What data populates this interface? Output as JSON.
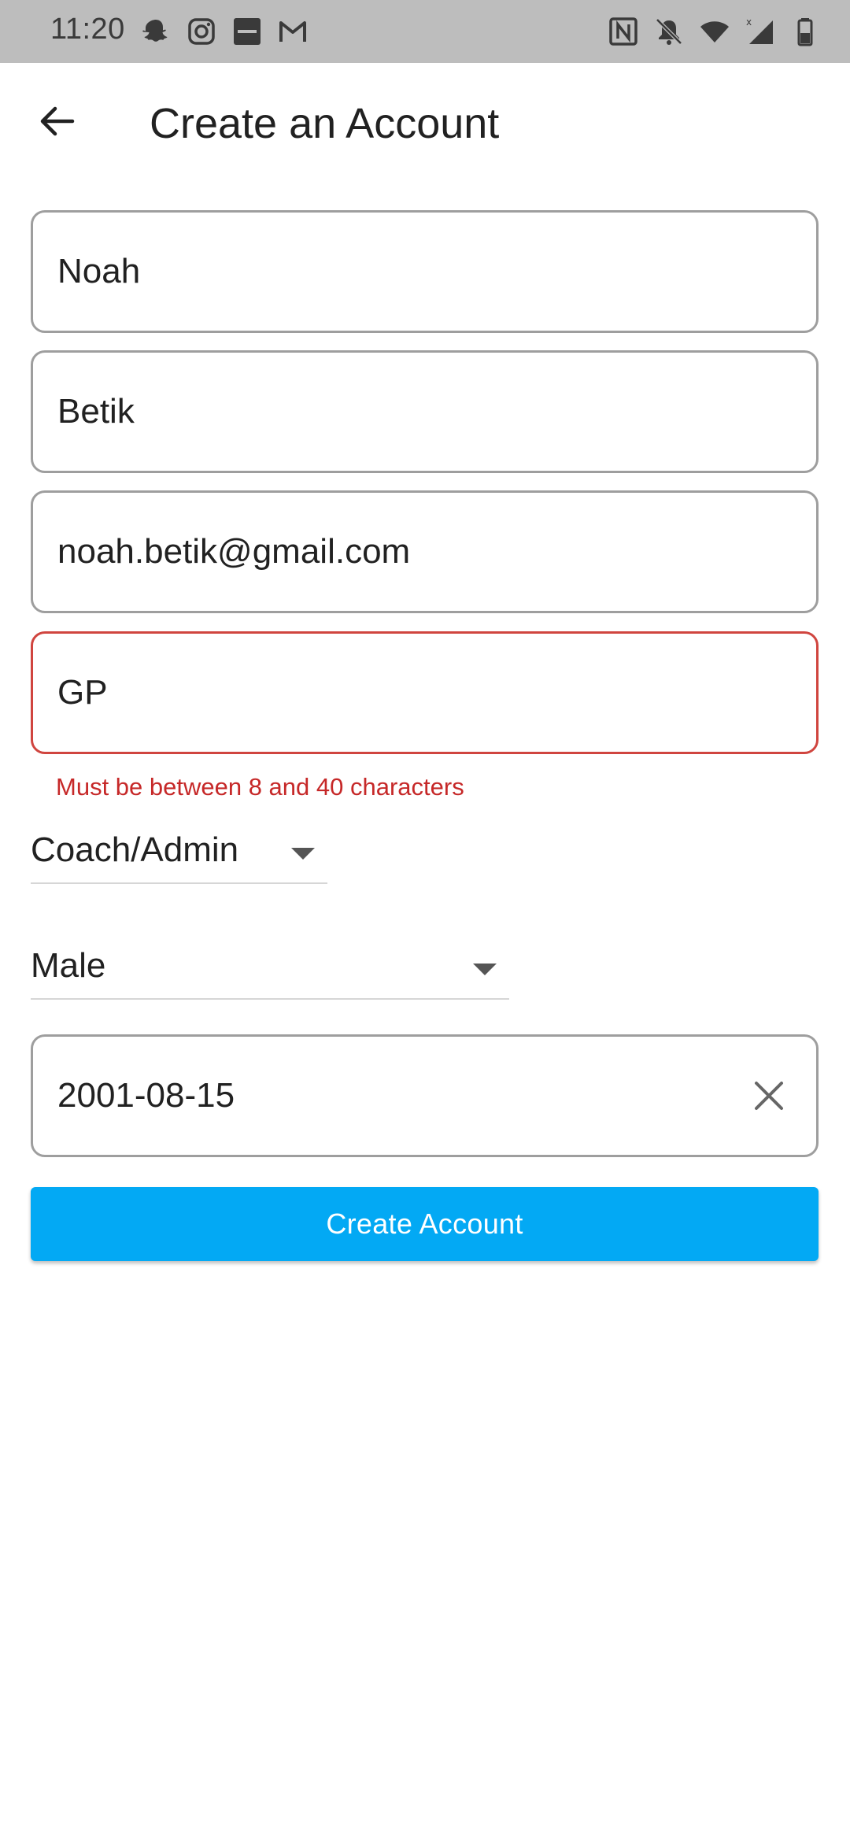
{
  "status_bar": {
    "time": "11:20",
    "left_icons": [
      "snapchat-icon",
      "instagram-icon",
      "tsn-icon",
      "gmail-icon"
    ],
    "right_icons": [
      "nfc-icon",
      "notifications-off-icon",
      "wifi-icon",
      "signal-icon",
      "battery-icon"
    ]
  },
  "header": {
    "back_icon": "arrow-back-icon",
    "title": "Create an Account"
  },
  "form": {
    "first_name": "Noah",
    "last_name": "Betik",
    "email": "noah.betik@gmail.com",
    "password": "GP",
    "password_error": "Must be between 8 and 40 characters",
    "role": "Coach/Admin",
    "gender": "Male",
    "birthdate": "2001-08-15",
    "birthdate_clear_icon": "close-icon",
    "submit_label": "Create Account"
  },
  "colors": {
    "accent": "#03a9f4",
    "error": "#c62828",
    "status_bar_bg": "#bdbdbd"
  }
}
